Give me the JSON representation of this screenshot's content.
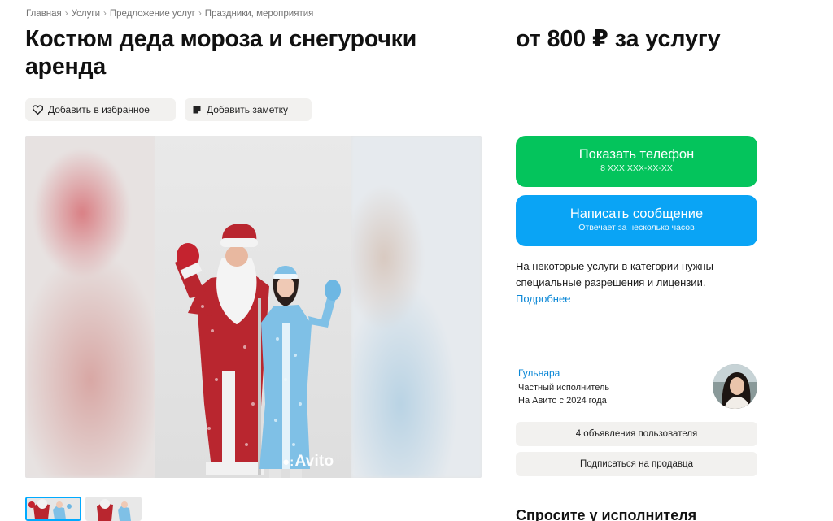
{
  "breadcrumb": [
    "Главная",
    "Услуги",
    "Предложение услуг",
    "Праздники, мероприятия"
  ],
  "listing": {
    "title": "Костюм деда мороза и снегурочки аренда",
    "price": "от 800 ₽ за услугу"
  },
  "actions": {
    "favorite": "Добавить в избранное",
    "note": "Добавить заметку"
  },
  "gallery": {
    "watermark": "Avito",
    "thumbnails": 2,
    "selected_thumbnail": 1
  },
  "contact": {
    "phone_label": "Показать телефон",
    "phone_masked": "8 XXX XXX-XX-XX",
    "message_label": "Написать сообщение",
    "message_sub": "Отвечает за несколько часов"
  },
  "notice": {
    "text": "На некоторые услуги в категории нужны специальные разрешения и лицензии.",
    "link": "Подробнее"
  },
  "seller": {
    "name": "Гульнара",
    "type": "Частный исполнитель",
    "since": "На Авито с 2024 года",
    "ads_button": "4 объявления пользователя",
    "subscribe_button": "Подписаться на продавца"
  },
  "ask": {
    "heading": "Спросите у исполнителя"
  },
  "colors": {
    "phone_button": "#04c45c",
    "message_button": "#0aa4f5",
    "link": "#0a87d6",
    "chip_bg": "#f2f1ef",
    "thumb_selected_border": "#00aaff"
  },
  "icons": [
    "heart-icon",
    "note-icon",
    "avito-dots-icon"
  ]
}
